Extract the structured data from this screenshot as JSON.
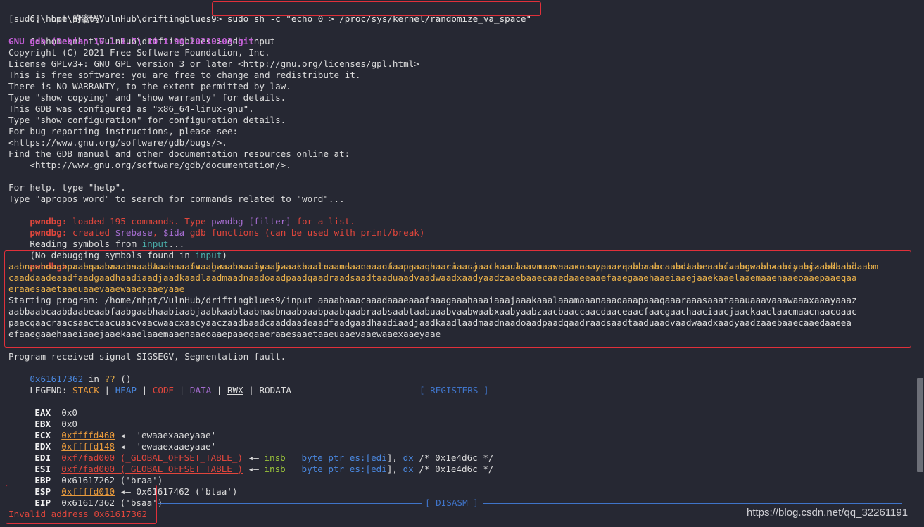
{
  "terminal": {
    "prompt1": "C:\\home\\nhpt\\VulnHub\\driftingblues9>",
    "cmd1": "sudo sh -c \"echo 0 > /proc/sys/kernel/randomize_va_space\"",
    "sudo_line": "[sudo] nhpt 的密码：",
    "prompt2": "C:\\home\\nhpt\\VulnHub\\driftingblues9>",
    "cmd2": " gdb input",
    "gdb_banner": "GNU gdb (Debian 10.1-1.7) 10.1.90.20210103-git",
    "copyright": "Copyright (C) 2021 Free Software Foundation, Inc.",
    "license": "License GPLv3+: GNU GPL version 3 or later <http://gnu.org/licenses/gpl.html>",
    "free_sw": "This is free software: you are free to change and redistribute it.",
    "no_warranty": "There is NO WARRANTY, to the extent permitted by law.",
    "show_copying": "Type \"show copying\" and \"show warranty\" for details.",
    "configured": "This GDB was configured as \"x86_64-linux-gnu\".",
    "show_config": "Type \"show configuration\" for configuration details.",
    "bug_report": "For bug reporting instructions, please see:",
    "bugs_url": "<https://www.gnu.org/software/gdb/bugs/>.",
    "find_manual": "Find the GDB manual and other documentation resources online at:",
    "doc_url": "    <http://www.gnu.org/software/gdb/documentation/>.",
    "help": "For help, type \"help\".",
    "apropos": "Type \"apropos word\" to search for commands related to \"word\"...",
    "pwndbg_tag": "pwndbg:",
    "loaded_a": " loaded 195 commands. Type ",
    "loaded_b": "pwndbg [filter]",
    "loaded_c": " for a list.",
    "created_a": " created ",
    "created_b": "$rebase",
    "created_c": ", ",
    "created_d": "$ida",
    "created_e": " gdb functions (can be used with print/break)",
    "reading_a": "Reading symbols from ",
    "reading_b": "input",
    "reading_c": "...",
    "nodebug_a": "(No debugging symbols found in ",
    "nodebug_b": "input",
    "nodebug_c": ")",
    "prompt_pwndbg": "pwndbg>",
    "run_cmd": " r aaaabaaacaaadaaaeaaafaaagaaahaaaiaaajaaakaaalaaamaaanaaaoaaapaaaqaaaraaasaaataaauaaavaaawaaaxaaayaaazaabbaabcaabdaabeaabfaabgaabhaabiaabjaabkaablaabm",
    "run_2": "aabnaaboaabpaabqaabraabsaabtaabuaabvaabwaabxaabyaabzaacbaaccaacdaaceaacfaacgaachaaciaacjaackaaclaacmaacnaacoaacpaacqaacraacsaactaacuaacvaacwaacxaacyaaczaadbaad",
    "run_3": "caaddaadeaadfaadgaadhaadiaadjaadkaadlaadmaadnaadoaadpaadqaadraadsaadtaaduaadvaadwaadxaadyaadzaaebaaecaaedaaeeaaefaaegaaehaaeiaaejaaekaaelaaemaaenaaeoaaepaaeqaa",
    "run_4": "eraaesaaetaaeuaaevaaewaaexaaeyaae",
    "start_1": "Starting program: /home/nhpt/VulnHub/driftingblues9/input aaaabaaacaaadaaaeaaafaaagaaahaaaiaaajaaakaaalaaamaaanaaaoaaapaaaqaaaraaasaaataaauaaavaaawaaaxaaayaaaz",
    "start_2": "aabbaabcaabdaabeaabfaabgaabhaabiaabjaabkaablaabmaabnaaboaabpaabqaabraabsaabtaabuaabvaabwaabxaabyaabzaacbaaccaacdaaceaacfaacgaachaaciaacjaackaaclaacmaacnaacoaac",
    "start_3": "paacqaacraacsaactaacuaacvaacwaacxaacyaaczaadbaadcaaddaadeaadfaadgaadhaadiaadjaadkaadlaadmaadnaadoaadpaadqaadraadsaadtaaduaadvaadwaadxaadyaadzaaebaaecaaedaaeea",
    "start_4": "efaaegaaehaaeiaaejaaekaaelaaemaaenaaeoaaepaaeqaaeraaesaaetaaeuaaevaaewaaexaaeyaae",
    "sigsegv": "Program received signal SIGSEGV, Segmentation fault.",
    "pc_addr": "0x61617362",
    "pc_in": " in ",
    "pc_q": "??",
    "pc_paren": " ()",
    "legend_label": "LEGEND: ",
    "legend_stack": "STACK",
    "legend_sep": " | ",
    "legend_heap": "HEAP",
    "legend_code": "CODE",
    "legend_data": "DATA",
    "legend_rwx": "RWX",
    "legend_rodata": "RODATA",
    "registers_title": "[ REGISTERS ]",
    "disasm_title": "[ DISASM ]",
    "arrow": " ◂— ",
    "insb": "insb",
    "insb_operands_a": "   byte ptr es:[",
    "insb_edi": "edi",
    "insb_operands_b": "], ",
    "insb_dx": "dx",
    "insb_comment": " /* 0x1e4d6c */",
    "invalid_addr": "Invalid address 0x61617362"
  },
  "registers": [
    {
      "name": "EAX",
      "value": "0x0",
      "kind": "plain"
    },
    {
      "name": "EBX",
      "value": "0x0",
      "kind": "plain"
    },
    {
      "name": "ECX",
      "value": "0xffffd460",
      "kind": "stack",
      "deref": "'ewaaexaaeyaae'"
    },
    {
      "name": "EDX",
      "value": "0xffffd148",
      "kind": "stack",
      "deref": "'ewaaexaaeyaae'"
    },
    {
      "name": "EDI",
      "value": "0xf7fad000 (_GLOBAL_OFFSET_TABLE_)",
      "kind": "code"
    },
    {
      "name": "ESI",
      "value": "0xf7fad000 (_GLOBAL_OFFSET_TABLE_)",
      "kind": "code"
    },
    {
      "name": "EBP",
      "value": "0x61617262 ('braa')",
      "kind": "plain"
    },
    {
      "name": "ESP",
      "value": "0xffffd010",
      "kind": "stack",
      "deref": "0x61617462 ('btaa')"
    },
    {
      "name": "EIP",
      "value": "0x61617362 ('bsaa')",
      "kind": "plain"
    }
  ],
  "watermark": "https://blog.csdn.net/qq_32261191",
  "colors": {
    "background": "#262833",
    "highlight_box": "#e0303a",
    "divider": "#3f74c9",
    "stack": "#e89a3c",
    "code": "#e0463c",
    "heap": "#4a88e0",
    "data": "#a66dd1",
    "gdb_banner": "#c35ed6"
  }
}
